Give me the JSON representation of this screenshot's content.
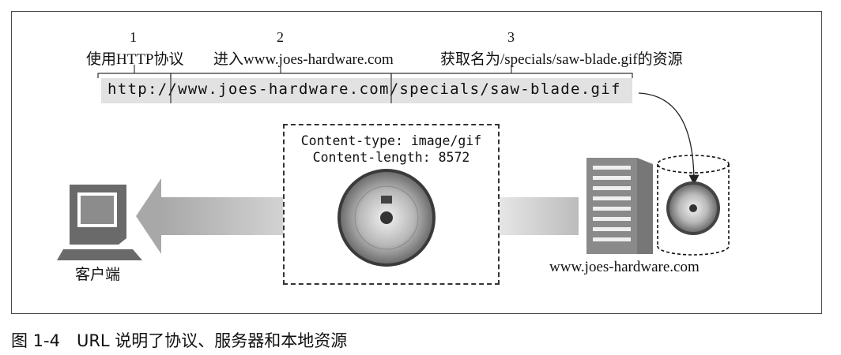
{
  "steps": [
    {
      "number": "1",
      "label": "使用HTTP协议"
    },
    {
      "number": "2",
      "label": "进入www.joes-hardware.com"
    },
    {
      "number": "3",
      "label": "获取名为/specials/saw-blade.gif的资源"
    }
  ],
  "url": "http://www.joes-hardware.com/specials/saw-blade.gif",
  "response": {
    "content_type": "Content-type: image/gif",
    "content_length": "Content-length: 8572"
  },
  "client_label": "客户端",
  "server_label": "www.joes-hardware.com",
  "caption": "图 1-4　URL 说明了协议、服务器和本地资源",
  "colors": {
    "url_bg": "#e2e2e2",
    "arrow": "#bdbdbd",
    "computer": "#6a6a6a",
    "server": "#777777"
  },
  "icons": [
    "computer-icon",
    "server-icon",
    "saw-blade-icon",
    "database-icon"
  ]
}
